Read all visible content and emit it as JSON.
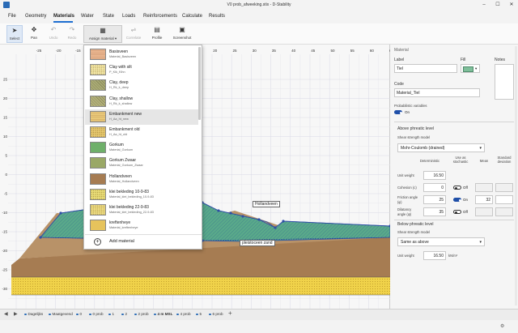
{
  "window": {
    "title": "V0 prob_afweeking.stix - D-Stability",
    "minimize": "–",
    "maximize": "☐",
    "close": "✕"
  },
  "menu": [
    "File",
    "Geometry",
    "Materials",
    "Water",
    "State",
    "Loads",
    "Reinforcements",
    "Calculate",
    "Results"
  ],
  "menu_active": "Materials",
  "toolbar": {
    "select": "Select",
    "pan": "Pan",
    "undo": "Undo",
    "redo": "Redo",
    "assign_material": "Assign material",
    "correlate": "Correlate",
    "profile": "Profile",
    "screenshot": "Screenshot"
  },
  "materials_dropdown": {
    "items": [
      {
        "name": "Basisveen",
        "code": "Material_Basisveen",
        "color": "#e9b58f",
        "pattern": "stripe"
      },
      {
        "name": "Clay with silt",
        "code": "P_Klk_Klhn",
        "color": "#f2e6a6",
        "pattern": "dots"
      },
      {
        "name": "Clay, deep",
        "code": "H_Rk_k_deep",
        "color": "#a9aa74",
        "pattern": "hatch"
      },
      {
        "name": "Clay, shallow",
        "code": "H_Rk_k_shallow",
        "color": "#b2b07a",
        "pattern": "hatch"
      },
      {
        "name": "Embankment new",
        "code": "H_Aa_ht_new",
        "color": "#e8c878",
        "pattern": "stripe"
      },
      {
        "name": "Embankment old",
        "code": "H_Aa_ht_old",
        "color": "#e6c86e",
        "pattern": "dots"
      },
      {
        "name": "Gorkum",
        "code": "Material_Gorkum",
        "color": "#6fb06a",
        "pattern": "plain"
      },
      {
        "name": "Gorkum Zwaar",
        "code": "Material_Gorkum_Zwaar",
        "color": "#9aa866",
        "pattern": "plain"
      },
      {
        "name": "Hollandveen",
        "code": "Material_Hollandveen",
        "color": "#a67c52",
        "pattern": "plain"
      },
      {
        "name": "klei bekleding 10-9-83",
        "code": "Material_klei_bekleding_10-9-83",
        "color": "#e9dd78",
        "pattern": "dots"
      },
      {
        "name": "klei bekleding 22-9-83",
        "code": "Material_klei_bekleding_22-9-83",
        "color": "#eddc82",
        "pattern": "dots"
      },
      {
        "name": "kreftenheye",
        "code": "Material_kreftenheye",
        "color": "#e6c35c",
        "pattern": "plain"
      }
    ],
    "highlighted_index": 4,
    "add_label": "Add material",
    "add_icon": "plus-circle-icon"
  },
  "canvas": {
    "x_ticks": [
      "-25",
      "-20",
      "-15",
      "-10",
      "-5",
      "0",
      "5",
      "10",
      "15",
      "20",
      "25",
      "30",
      "35",
      "40",
      "45",
      "50",
      "55",
      "60",
      "65"
    ],
    "y_ticks": [
      "25",
      "20",
      "15",
      "10",
      "5",
      "0",
      "-5",
      "-10",
      "-15",
      "-20",
      "-25",
      "-30"
    ],
    "labels": {
      "hollandveen": "Hollandveen",
      "pleistoceen": "pleistoceen zand"
    },
    "colors": {
      "embankment": "#5aaa8a",
      "clay": "#a67c52",
      "sand": "#f0d24a"
    }
  },
  "properties": {
    "section_title": "Material",
    "label_caption": "Label",
    "label_value": "Tiel",
    "fill_caption": "Fill",
    "fill_color": "#7fbf9a",
    "notes_caption": "Notes",
    "code_caption": "Code",
    "code_value": "Material_Tiel",
    "probabilistic_caption": "Probabilistic variables",
    "probabilistic_state": "On",
    "above": {
      "title": "Above phreatic level",
      "model_caption": "Shear strength model",
      "model_value": "Mohr-Coulomb (drained)",
      "col_deterministic": "Deterministic",
      "col_stochastic": "Use as stochastic",
      "col_mean": "Mean",
      "col_std": "Standard deviation",
      "rows": [
        {
          "label": "Unit weight",
          "value": "16.50",
          "unit": "",
          "toggle": "",
          "mean": "",
          "std": ""
        },
        {
          "label": "Cohesion (c)",
          "value": "0",
          "unit": "kPa",
          "toggle": "Off",
          "mean": "",
          "std": ""
        },
        {
          "label": "Friction angle (φ)",
          "value": "25",
          "unit": "°",
          "toggle": "On",
          "mean": "32",
          "std": ""
        },
        {
          "label": "Dilatancy angle (ψ)",
          "value": "35",
          "unit": "°",
          "toggle": "Off",
          "mean": "",
          "std": ""
        }
      ]
    },
    "below": {
      "title": "Below phreatic level",
      "model_caption": "Shear strength model",
      "model_value": "Same as above",
      "unit_weight_label": "Unit weight",
      "unit_weight_value": "16.50",
      "unit_weight_unit": "kN/m³"
    }
  },
  "tabs": [
    "Dagelijks",
    "Maatgevend",
    "0",
    "0 prob",
    "1",
    "2",
    "2 prob",
    "4 m MSL",
    "4 prob",
    "5",
    "6 prob"
  ],
  "tab_active": "4 m MSL",
  "tab_add": "+",
  "tab_prev": "◀",
  "tab_next": "▶"
}
